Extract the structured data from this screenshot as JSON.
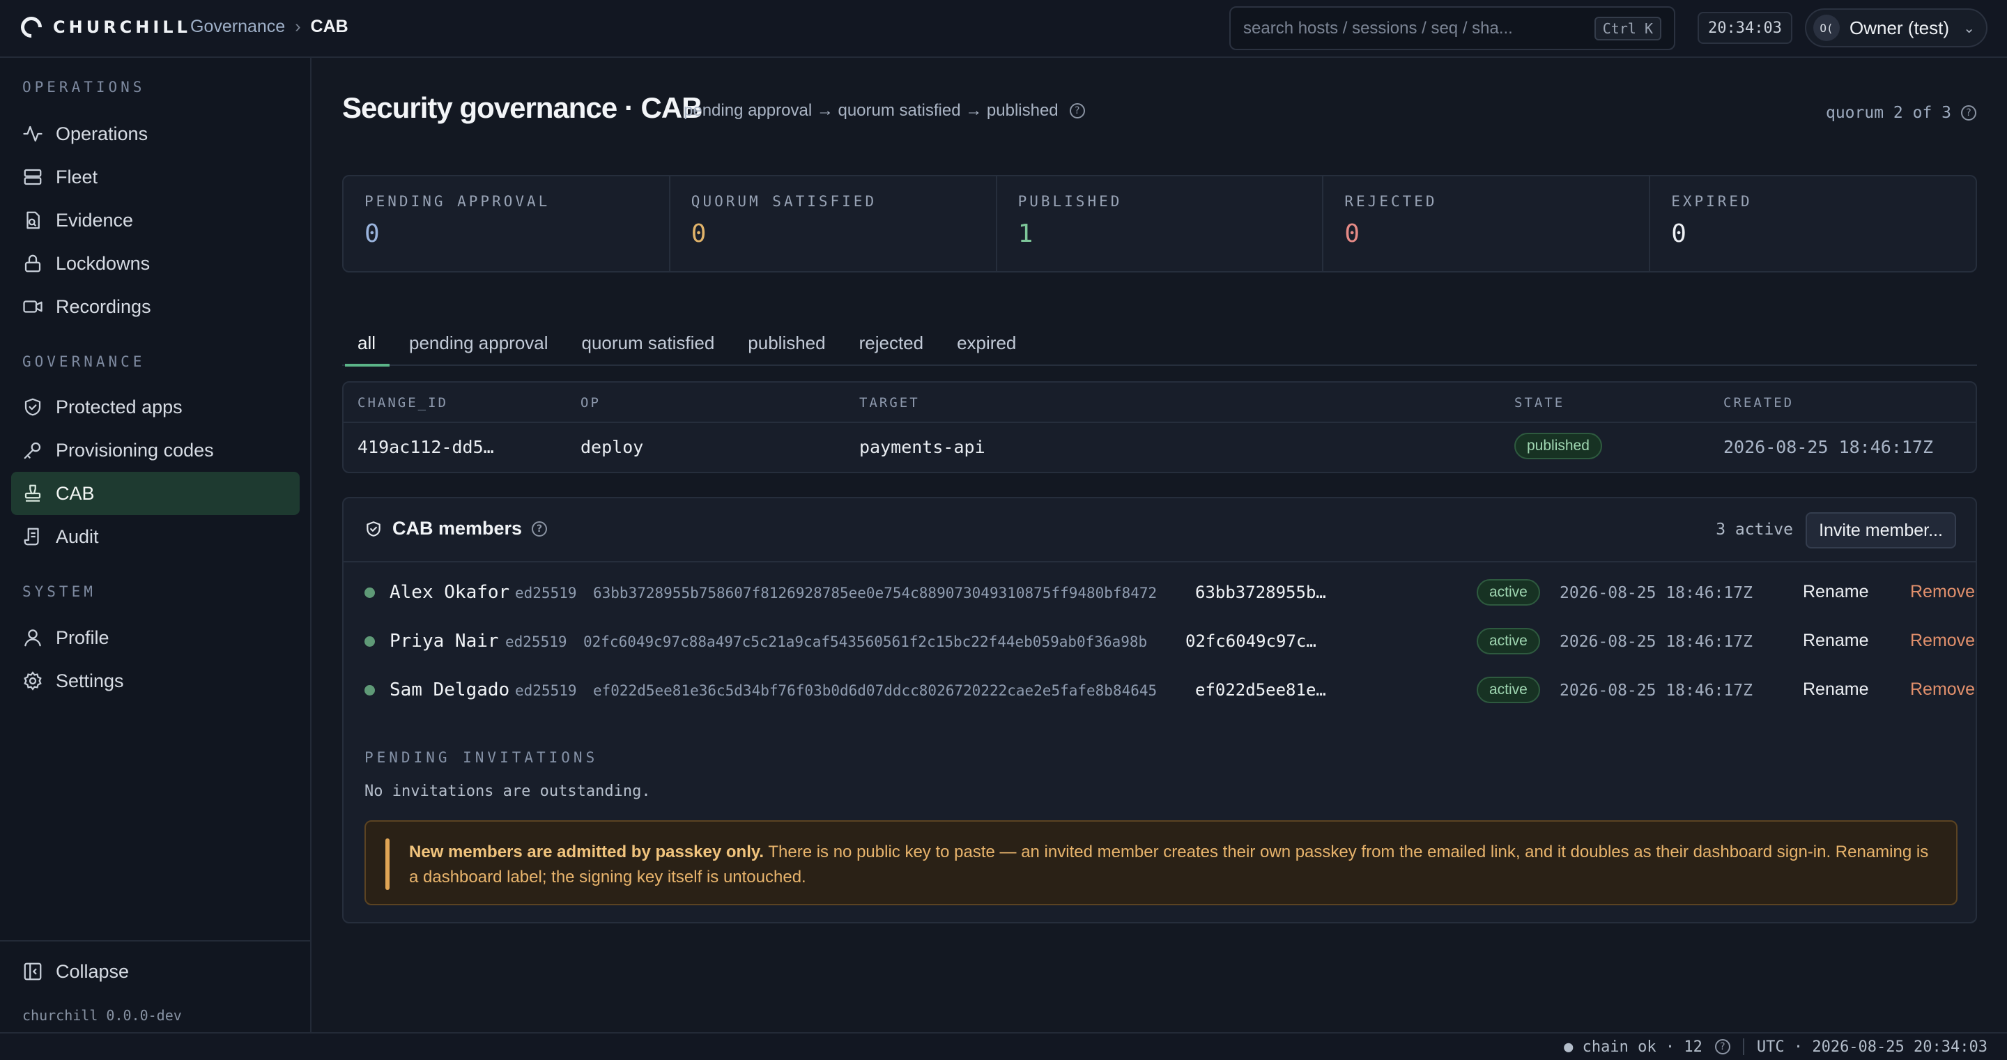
{
  "app": {
    "name": "CHURCHILL",
    "version": "churchill 0.0.0-dev"
  },
  "breadcrumb": {
    "parent": "Governance",
    "separator": "›",
    "current": "CAB"
  },
  "search": {
    "placeholder": "search hosts / sessions / seq / sha...",
    "shortcut": "Ctrl K"
  },
  "clock": "20:34:03",
  "user": {
    "initials": "O(",
    "name": "Owner (test)"
  },
  "sidebar": {
    "sections": [
      {
        "title": "OPERATIONS",
        "items": [
          {
            "label": "Operations",
            "icon": "activity-icon"
          },
          {
            "label": "Fleet",
            "icon": "server-icon"
          },
          {
            "label": "Evidence",
            "icon": "file-search-icon"
          },
          {
            "label": "Lockdowns",
            "icon": "lock-icon"
          },
          {
            "label": "Recordings",
            "icon": "video-icon"
          }
        ]
      },
      {
        "title": "GOVERNANCE",
        "items": [
          {
            "label": "Protected apps",
            "icon": "shield-check-icon"
          },
          {
            "label": "Provisioning codes",
            "icon": "key-icon"
          },
          {
            "label": "CAB",
            "icon": "stamp-icon",
            "active": true
          },
          {
            "label": "Audit",
            "icon": "scroll-icon"
          }
        ]
      },
      {
        "title": "SYSTEM",
        "items": [
          {
            "label": "Profile",
            "icon": "user-icon"
          },
          {
            "label": "Settings",
            "icon": "gear-icon"
          }
        ]
      }
    ],
    "collapse_label": "Collapse"
  },
  "page": {
    "title": "Security governance · CAB",
    "subtitle": "pending approval → quorum satisfied → published",
    "quorum": "quorum 2 of 3"
  },
  "stats": [
    {
      "label": "PENDING APPROVAL",
      "value": "0",
      "color": "#9ab4dd"
    },
    {
      "label": "QUORUM SATISFIED",
      "value": "0",
      "color": "#e0b36a"
    },
    {
      "label": "PUBLISHED",
      "value": "1",
      "color": "#7ec79a"
    },
    {
      "label": "REJECTED",
      "value": "0",
      "color": "#e58a86"
    },
    {
      "label": "EXPIRED",
      "value": "0",
      "color": "#eef1f5"
    }
  ],
  "tabs": [
    "all",
    "pending approval",
    "quorum satisfied",
    "published",
    "rejected",
    "expired"
  ],
  "active_tab": "all",
  "changes_table": {
    "columns": [
      "CHANGE_ID",
      "OP",
      "TARGET",
      "STATE",
      "CREATED"
    ],
    "rows": [
      {
        "change_id": "419ac112-dd5…",
        "op": "deploy",
        "target": "payments-api",
        "state": "published",
        "created": "2026-08-25 18:46:17Z"
      }
    ]
  },
  "members": {
    "title": "CAB members",
    "active_count": "3 active",
    "invite_label": "Invite member...",
    "rows": [
      {
        "name": "Alex Okafor",
        "algorithm": "ed25519",
        "key": "63bb3728955b758607f8126928785ee0e754c889073049310875ff9480bf8472",
        "key_short": "63bb3728955b…",
        "status": "active",
        "date": "2026-08-25 18:46:17Z",
        "rename": "Rename",
        "remove": "Remove"
      },
      {
        "name": "Priya Nair",
        "algorithm": "ed25519",
        "key": "02fc6049c97c88a497c5c21a9caf543560561f2c15bc22f44eb059ab0f36a98b",
        "key_short": "02fc6049c97c…",
        "status": "active",
        "date": "2026-08-25 18:46:17Z",
        "rename": "Rename",
        "remove": "Remove"
      },
      {
        "name": "Sam Delgado",
        "algorithm": "ed25519",
        "key": "ef022d5ee81e36c5d34bf76f03b0d6d07ddcc8026720222cae2e5fafe8b84645",
        "key_short": "ef022d5ee81e…",
        "status": "active",
        "date": "2026-08-25 18:46:17Z",
        "rename": "Rename",
        "remove": "Remove"
      }
    ],
    "pending_title": "PENDING INVITATIONS",
    "pending_empty": "No invitations are outstanding.",
    "notice_bold": "New members are admitted by passkey only.",
    "notice_text": " There is no public key to paste — an invited member creates their own passkey from the emailed link, and it doubles as their dashboard sign-in. Renaming is a dashboard label; the signing key itself is untouched."
  },
  "statusbar": {
    "chain": "● chain ok · 12",
    "time": "UTC · 2026-08-25 20:34:03"
  }
}
